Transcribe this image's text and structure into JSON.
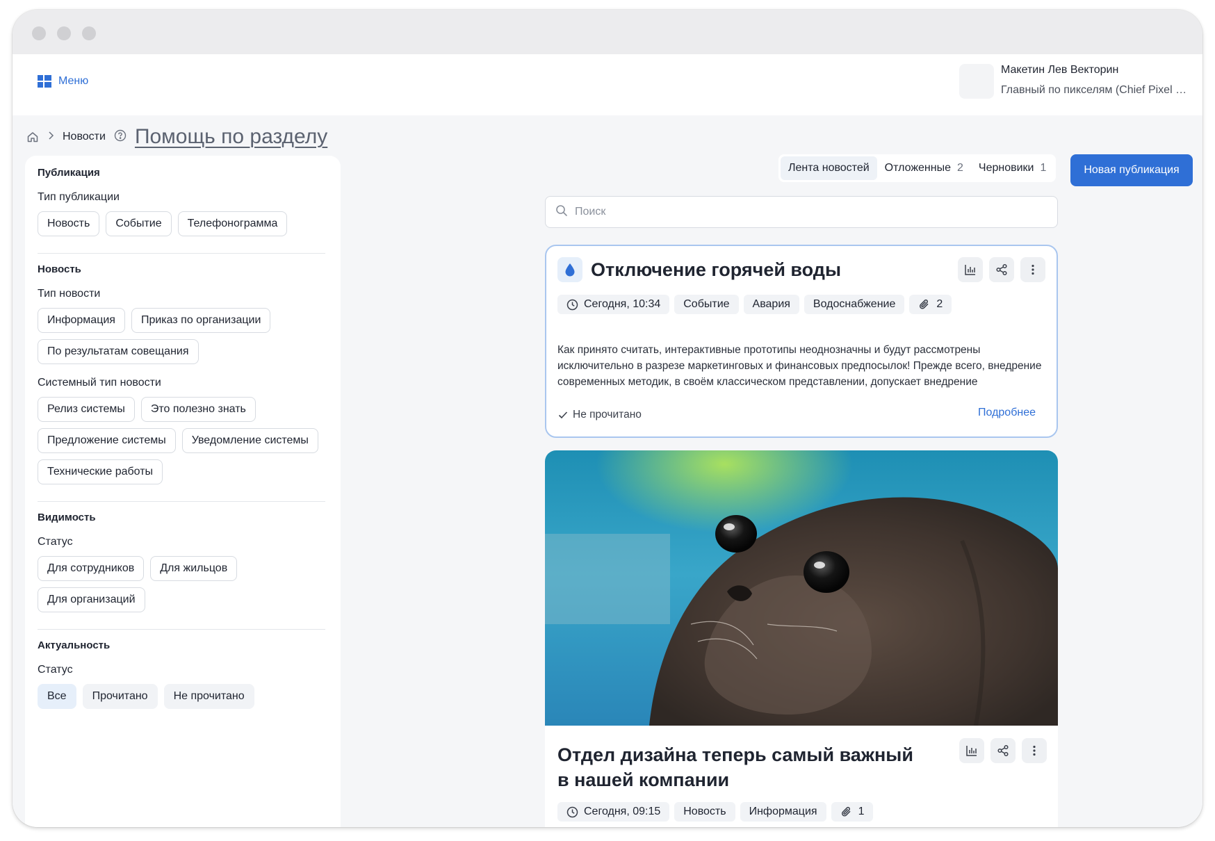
{
  "header": {
    "menu_label": "Меню",
    "user_name": "Макетин Лев Векторин",
    "user_role": "Главный по пикселям (Chief Pixel Officer)"
  },
  "breadcrumb": {
    "current": "Новости",
    "help_link": "Помощь по разделу"
  },
  "filters": {
    "publication": {
      "title": "Публикация",
      "type_label": "Тип публикации",
      "types": [
        "Новость",
        "Событие",
        "Телефонограмма"
      ]
    },
    "news": {
      "title": "Новость",
      "type_label": "Тип новости",
      "types": [
        "Информация",
        "Приказ по организации",
        "По результатам совещания"
      ],
      "system_type_label": "Системный тип новости",
      "system_types": [
        "Релиз системы",
        "Это полезно знать",
        "Предложение системы",
        "Уведомление системы",
        "Технические работы"
      ]
    },
    "visibility": {
      "title": "Видимость",
      "status_label": "Статус",
      "statuses": [
        "Для сотрудников",
        "Для жильцов",
        "Для организаций"
      ]
    },
    "relevance": {
      "title": "Актуальность",
      "status_label": "Статус",
      "statuses": [
        "Все",
        "Прочитано",
        "Не прочитано"
      ],
      "selected": "Все"
    }
  },
  "tabs": [
    {
      "label": "Лента новостей",
      "count": ""
    },
    {
      "label": "Отложенные",
      "count": "2"
    },
    {
      "label": "Черновики",
      "count": "1"
    }
  ],
  "new_publication_label": "Новая публикация",
  "search": {
    "placeholder": "Поиск",
    "value": ""
  },
  "posts": [
    {
      "icon": "water-drop-icon",
      "title": "Отключение горячей воды",
      "time": "Сегодня, 10:34",
      "tags": [
        "Событие",
        "Авария",
        "Водоснабжение"
      ],
      "attachments": "2",
      "text": "Как принято считать, интерактивные прототипы неоднозначны и будут рассмотрены исключительно в разрезе маркетинговых и финансовых предпосылок! Прежде всего, внедрение современных методик, в своём классическом представлении, допускает внедрение",
      "read_status": "Не прочитано",
      "more_label": "Подробнее"
    },
    {
      "image": "seal-photo",
      "title": "Отдел дизайна теперь самый важный в нашей компании",
      "time": "Сегодня, 09:15",
      "tags": [
        "Новость",
        "Информация"
      ],
      "attachments": "1"
    }
  ],
  "colors": {
    "accent": "#2f6fd6",
    "page_background": "#f5f6f8",
    "chip_active": "#e6effa",
    "card_highlight_border": "#a9c6ef"
  }
}
